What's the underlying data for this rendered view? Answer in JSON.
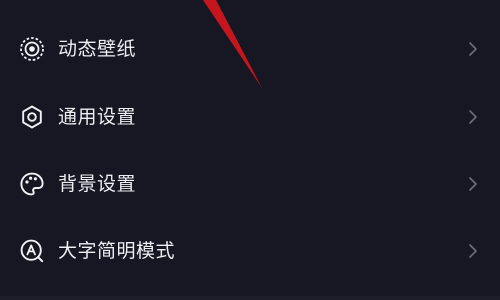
{
  "settings_menu": {
    "items": [
      {
        "label": "动态壁纸",
        "icon": "dynamic-wallpaper-icon"
      },
      {
        "label": "通用设置",
        "icon": "gear-icon"
      },
      {
        "label": "背景设置",
        "icon": "palette-icon"
      },
      {
        "label": "大字简明模式",
        "icon": "large-font-mode-icon"
      }
    ],
    "chevron_icon": "chevron-right-icon"
  },
  "colors": {
    "background": "#161722",
    "text": "#ededf2",
    "icon": "#f2f2f6",
    "chevron": "#6d6e78",
    "annotation_arrow": "#c4161c"
  }
}
